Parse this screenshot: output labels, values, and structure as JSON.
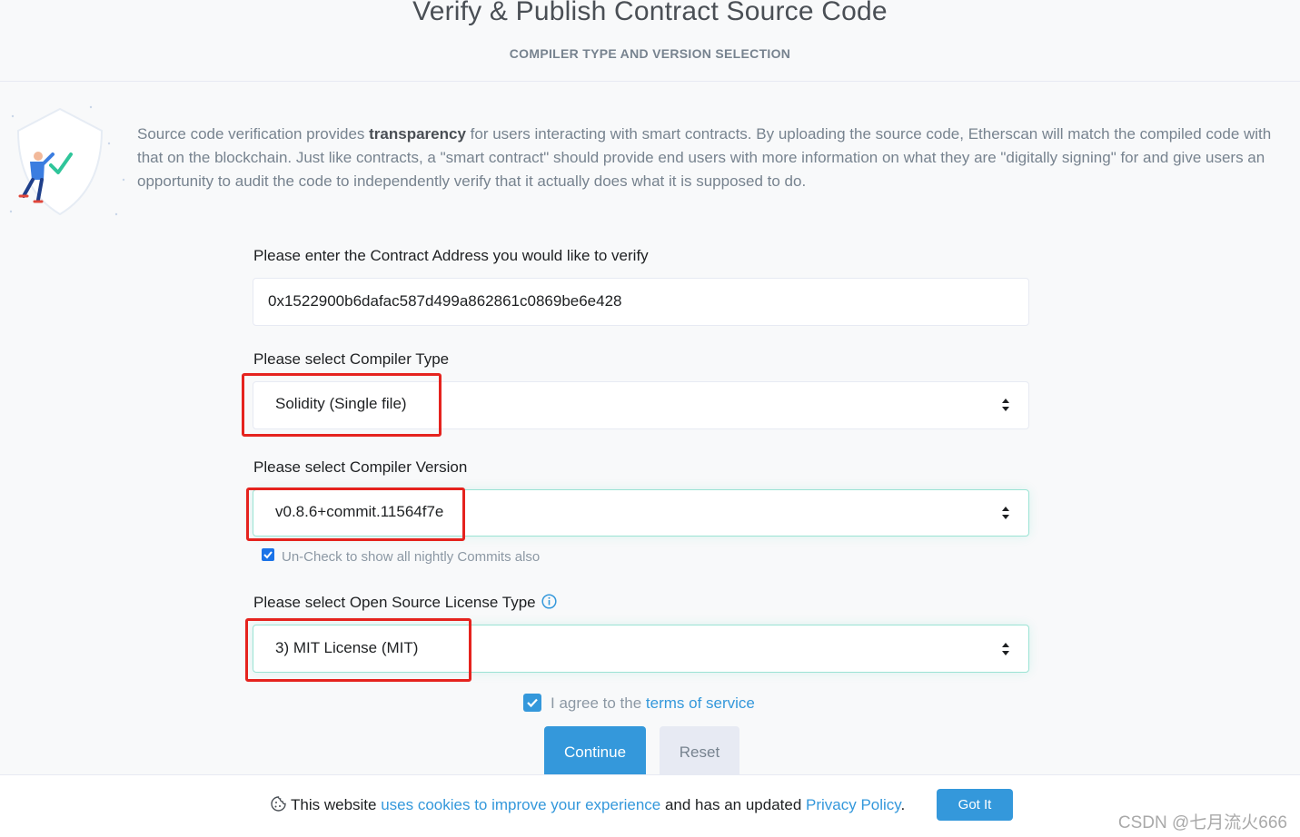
{
  "header": {
    "title": "Verify & Publish Contract Source Code",
    "subtitle": "COMPILER TYPE AND VERSION SELECTION"
  },
  "intro": {
    "text_before": "Source code verification provides ",
    "bold": "transparency",
    "text_after": " for users interacting with smart contracts. By uploading the source code, Etherscan will match the compiled code with that on the blockchain. Just like contracts, a \"smart contract\" should provide end users with more information on what they are \"digitally signing\" for and give users an opportunity to audit the code to independently verify that it actually does what it is supposed to do."
  },
  "form": {
    "address_label": "Please enter the Contract Address you would like to verify",
    "address_value": "0x1522900b6dafac587d499a862861c0869be6e428",
    "compiler_type_label": "Please select Compiler Type",
    "compiler_type_value": "Solidity (Single file)",
    "compiler_version_label": "Please select Compiler Version",
    "compiler_version_value": "v0.8.6+commit.11564f7e",
    "nightly_label": "Un-Check to show all nightly Commits also",
    "license_label": "Please select Open Source License Type",
    "license_value": "3) MIT License (MIT)",
    "agree_prefix": "I agree to the ",
    "agree_link": "terms of service",
    "continue_label": "Continue",
    "reset_label": "Reset"
  },
  "cookie": {
    "prefix": "This website ",
    "link1": "uses cookies to improve your experience",
    "middle": " and has an updated ",
    "link2": "Privacy Policy",
    "suffix": ".",
    "button": "Got It"
  },
  "watermark": "CSDN @七月流火666",
  "colors": {
    "accent": "#3498db",
    "highlight": "#e5231e",
    "muted": "#77838f"
  }
}
